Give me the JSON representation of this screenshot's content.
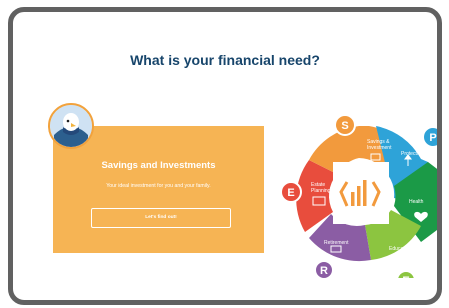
{
  "page": {
    "title": "What is your financial need?"
  },
  "card": {
    "title": "Savings and Investments",
    "subtitle": "Your ideal investment for you and your family.",
    "button_label": "Let's find out!"
  },
  "wheel": {
    "segments": [
      {
        "letter": "S",
        "label_line1": "Savings &",
        "label_line2": "Investment",
        "color": "#f29a3d"
      },
      {
        "letter": "P",
        "label_line1": "Protection",
        "label_line2": "",
        "color": "#2ea3d8"
      },
      {
        "letter": "",
        "label_line1": "Health",
        "label_line2": "",
        "color": "#1b9a47"
      },
      {
        "letter": "E",
        "label_line1": "Education",
        "label_line2": "",
        "color": "#8cc540"
      },
      {
        "letter": "R",
        "label_line1": "Retirement",
        "label_line2": "",
        "color": "#8b5da4"
      },
      {
        "letter": "E",
        "label_line1": "Estate",
        "label_line2": "Planning",
        "color": "#e84d3d"
      }
    ]
  }
}
